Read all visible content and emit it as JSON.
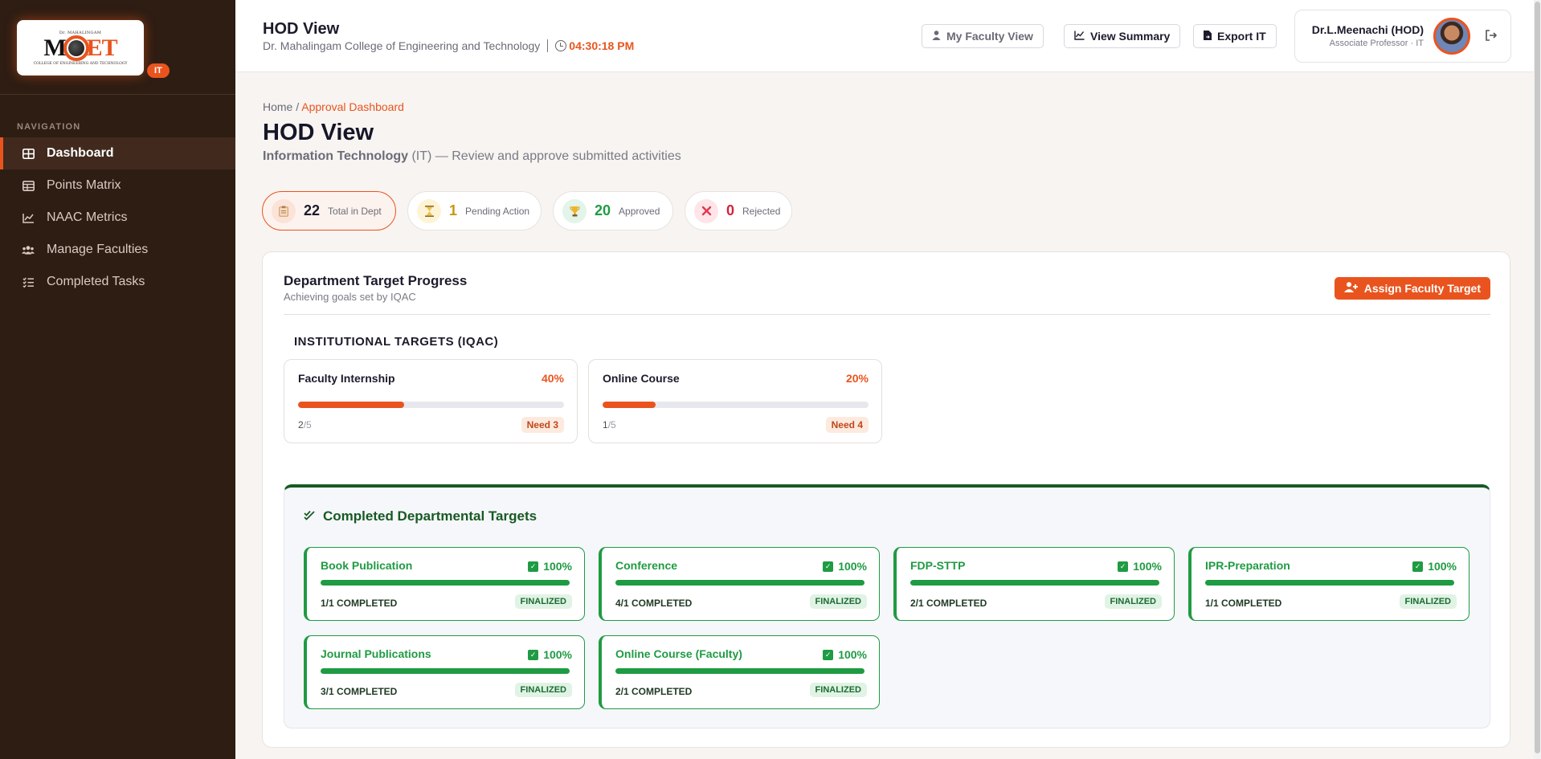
{
  "sidebar": {
    "logo": {
      "small": "Dr. MAHALINGAM",
      "main_left": "M",
      "main_right": "ET",
      "sub": "COLLEGE OF ENGINEERING AND TECHNOLOGY"
    },
    "dept_badge": "IT",
    "nav_title": "NAVIGATION",
    "items": [
      {
        "label": "Dashboard",
        "icon": "dashboard-icon",
        "active": true
      },
      {
        "label": "Points Matrix",
        "icon": "table-icon",
        "active": false
      },
      {
        "label": "NAAC Metrics",
        "icon": "chart-line-icon",
        "active": false
      },
      {
        "label": "Manage Faculties",
        "icon": "users-icon",
        "active": false
      },
      {
        "label": "Completed Tasks",
        "icon": "list-check-icon",
        "active": false
      }
    ]
  },
  "header": {
    "title": "HOD View",
    "college": "Dr. Mahalingam College of Engineering and Technology",
    "time": "04:30:18 PM",
    "buttons": {
      "faculty_view": "My Faculty View",
      "summary": "View Summary",
      "export": "Export IT"
    },
    "user": {
      "name": "Dr.L.Meenachi (HOD)",
      "role": "Associate Professor · IT"
    }
  },
  "breadcrumb": {
    "home": "Home",
    "sep": " / ",
    "current": "Approval Dashboard"
  },
  "page": {
    "title": "HOD View",
    "dept": "Information Technology",
    "subtitle_rest": " (IT) — Review and approve submitted activities"
  },
  "stats": [
    {
      "value": "22",
      "label": "Total in Dept",
      "icon": "clipboard-icon",
      "color": "#1b1b2b"
    },
    {
      "value": "1",
      "label": "Pending Action",
      "icon": "hourglass-icon",
      "color": "#c8960f"
    },
    {
      "value": "20",
      "label": "Approved",
      "icon": "trophy-icon",
      "color": "#1f9b43"
    },
    {
      "value": "0",
      "label": "Rejected",
      "icon": "x-icon",
      "color": "#d2233a"
    }
  ],
  "target_progress": {
    "title": "Department Target Progress",
    "subtitle": "Achieving goals set by IQAC",
    "assign_button": "Assign Faculty Target",
    "institutional_title": "INSTITUTIONAL TARGETS (IQAC)",
    "institutional": [
      {
        "name": "Faculty Internship",
        "percent_label": "40%",
        "progress": 0.4,
        "done": "2",
        "total": "/5",
        "need": "Need 3"
      },
      {
        "name": "Online Course",
        "percent_label": "20%",
        "progress": 0.2,
        "done": "1",
        "total": "/5",
        "need": "Need 4"
      }
    ],
    "completed_title": "Completed Departmental Targets",
    "completed": [
      {
        "name": "Book Publication",
        "percent": "100%",
        "count": "1/1 COMPLETED",
        "status": "FINALIZED"
      },
      {
        "name": "Conference",
        "percent": "100%",
        "count": "4/1 COMPLETED",
        "status": "FINALIZED"
      },
      {
        "name": "FDP-STTP",
        "percent": "100%",
        "count": "2/1 COMPLETED",
        "status": "FINALIZED"
      },
      {
        "name": "IPR-Preparation",
        "percent": "100%",
        "count": "1/1 COMPLETED",
        "status": "FINALIZED"
      },
      {
        "name": "Journal Publications",
        "percent": "100%",
        "count": "3/1 COMPLETED",
        "status": "FINALIZED"
      },
      {
        "name": "Online Course (Faculty)",
        "percent": "100%",
        "count": "2/1 COMPLETED",
        "status": "FINALIZED"
      }
    ]
  },
  "colors": {
    "accent": "#e9541e",
    "sidebar": "#2e1d13",
    "success": "#1f9b43",
    "success_dark": "#175a23"
  }
}
